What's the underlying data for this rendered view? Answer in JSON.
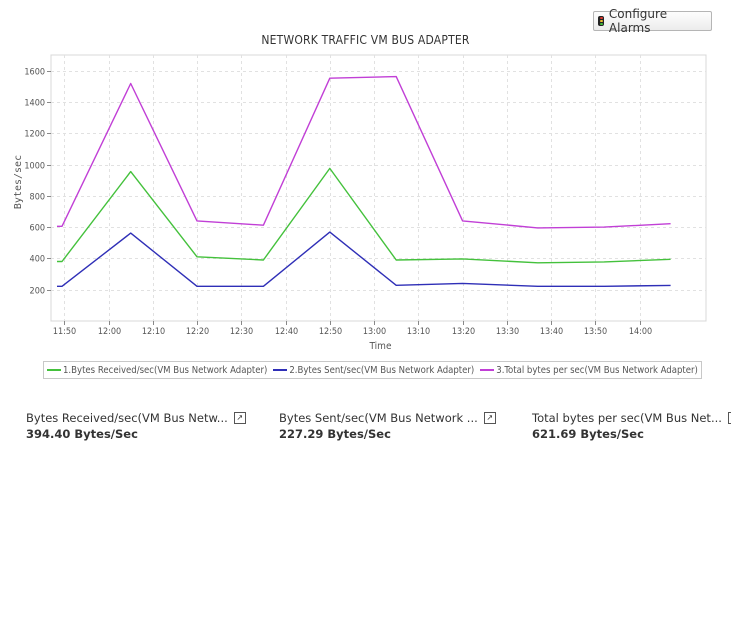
{
  "toolbar": {
    "configure_alarms_label": "Configure Alarms"
  },
  "colors": {
    "received": "#44c13c",
    "sent": "#2f2fb7",
    "total": "#c13fd6",
    "grid": "#e1e1e1"
  },
  "chart_data": {
    "type": "line",
    "title": "NETWORK TRAFFIC VM BUS ADAPTER",
    "xlabel": "Time",
    "ylabel": "Bytes/sec",
    "ylim": [
      0,
      1700
    ],
    "yticks": [
      200,
      400,
      600,
      800,
      1000,
      1200,
      1400,
      1600
    ],
    "xticks": [
      "11:50",
      "12:00",
      "12:10",
      "12:20",
      "12:30",
      "12:40",
      "12:50",
      "13:00",
      "13:10",
      "13:20",
      "13:30",
      "13:40",
      "13:50",
      "14:00"
    ],
    "grid": true,
    "legend_position": "bottom",
    "x": [
      "11:50",
      "12:05",
      "12:20",
      "12:35",
      "12:50",
      "13:05",
      "13:20",
      "13:37",
      "13:52",
      "14:07"
    ],
    "series": [
      {
        "name": "1.Bytes Received/sec(VM Bus Network Adapter)",
        "values": [
          380,
          955,
          410,
          390,
          975,
          390,
          397,
          372,
          378,
          394.4
        ]
      },
      {
        "name": "2.Bytes Sent/sec(VM Bus Network Adapter)",
        "values": [
          222,
          562,
          222,
          222,
          568,
          228,
          240,
          222,
          222,
          227.29
        ]
      },
      {
        "name": "3.Total bytes per sec(VM Bus Network Adapter)",
        "values": [
          605,
          1518,
          640,
          612,
          1552,
          1562,
          640,
          595,
          600,
          621.69
        ]
      }
    ]
  },
  "stats": [
    {
      "label": "Bytes Received/sec(VM Bus Netw...",
      "value": "394.40 Bytes/Sec"
    },
    {
      "label": "Bytes Sent/sec(VM Bus Network ...",
      "value": "227.29 Bytes/Sec"
    },
    {
      "label": "Total bytes per sec(VM Bus Net...",
      "value": "621.69 Bytes/Sec"
    }
  ]
}
